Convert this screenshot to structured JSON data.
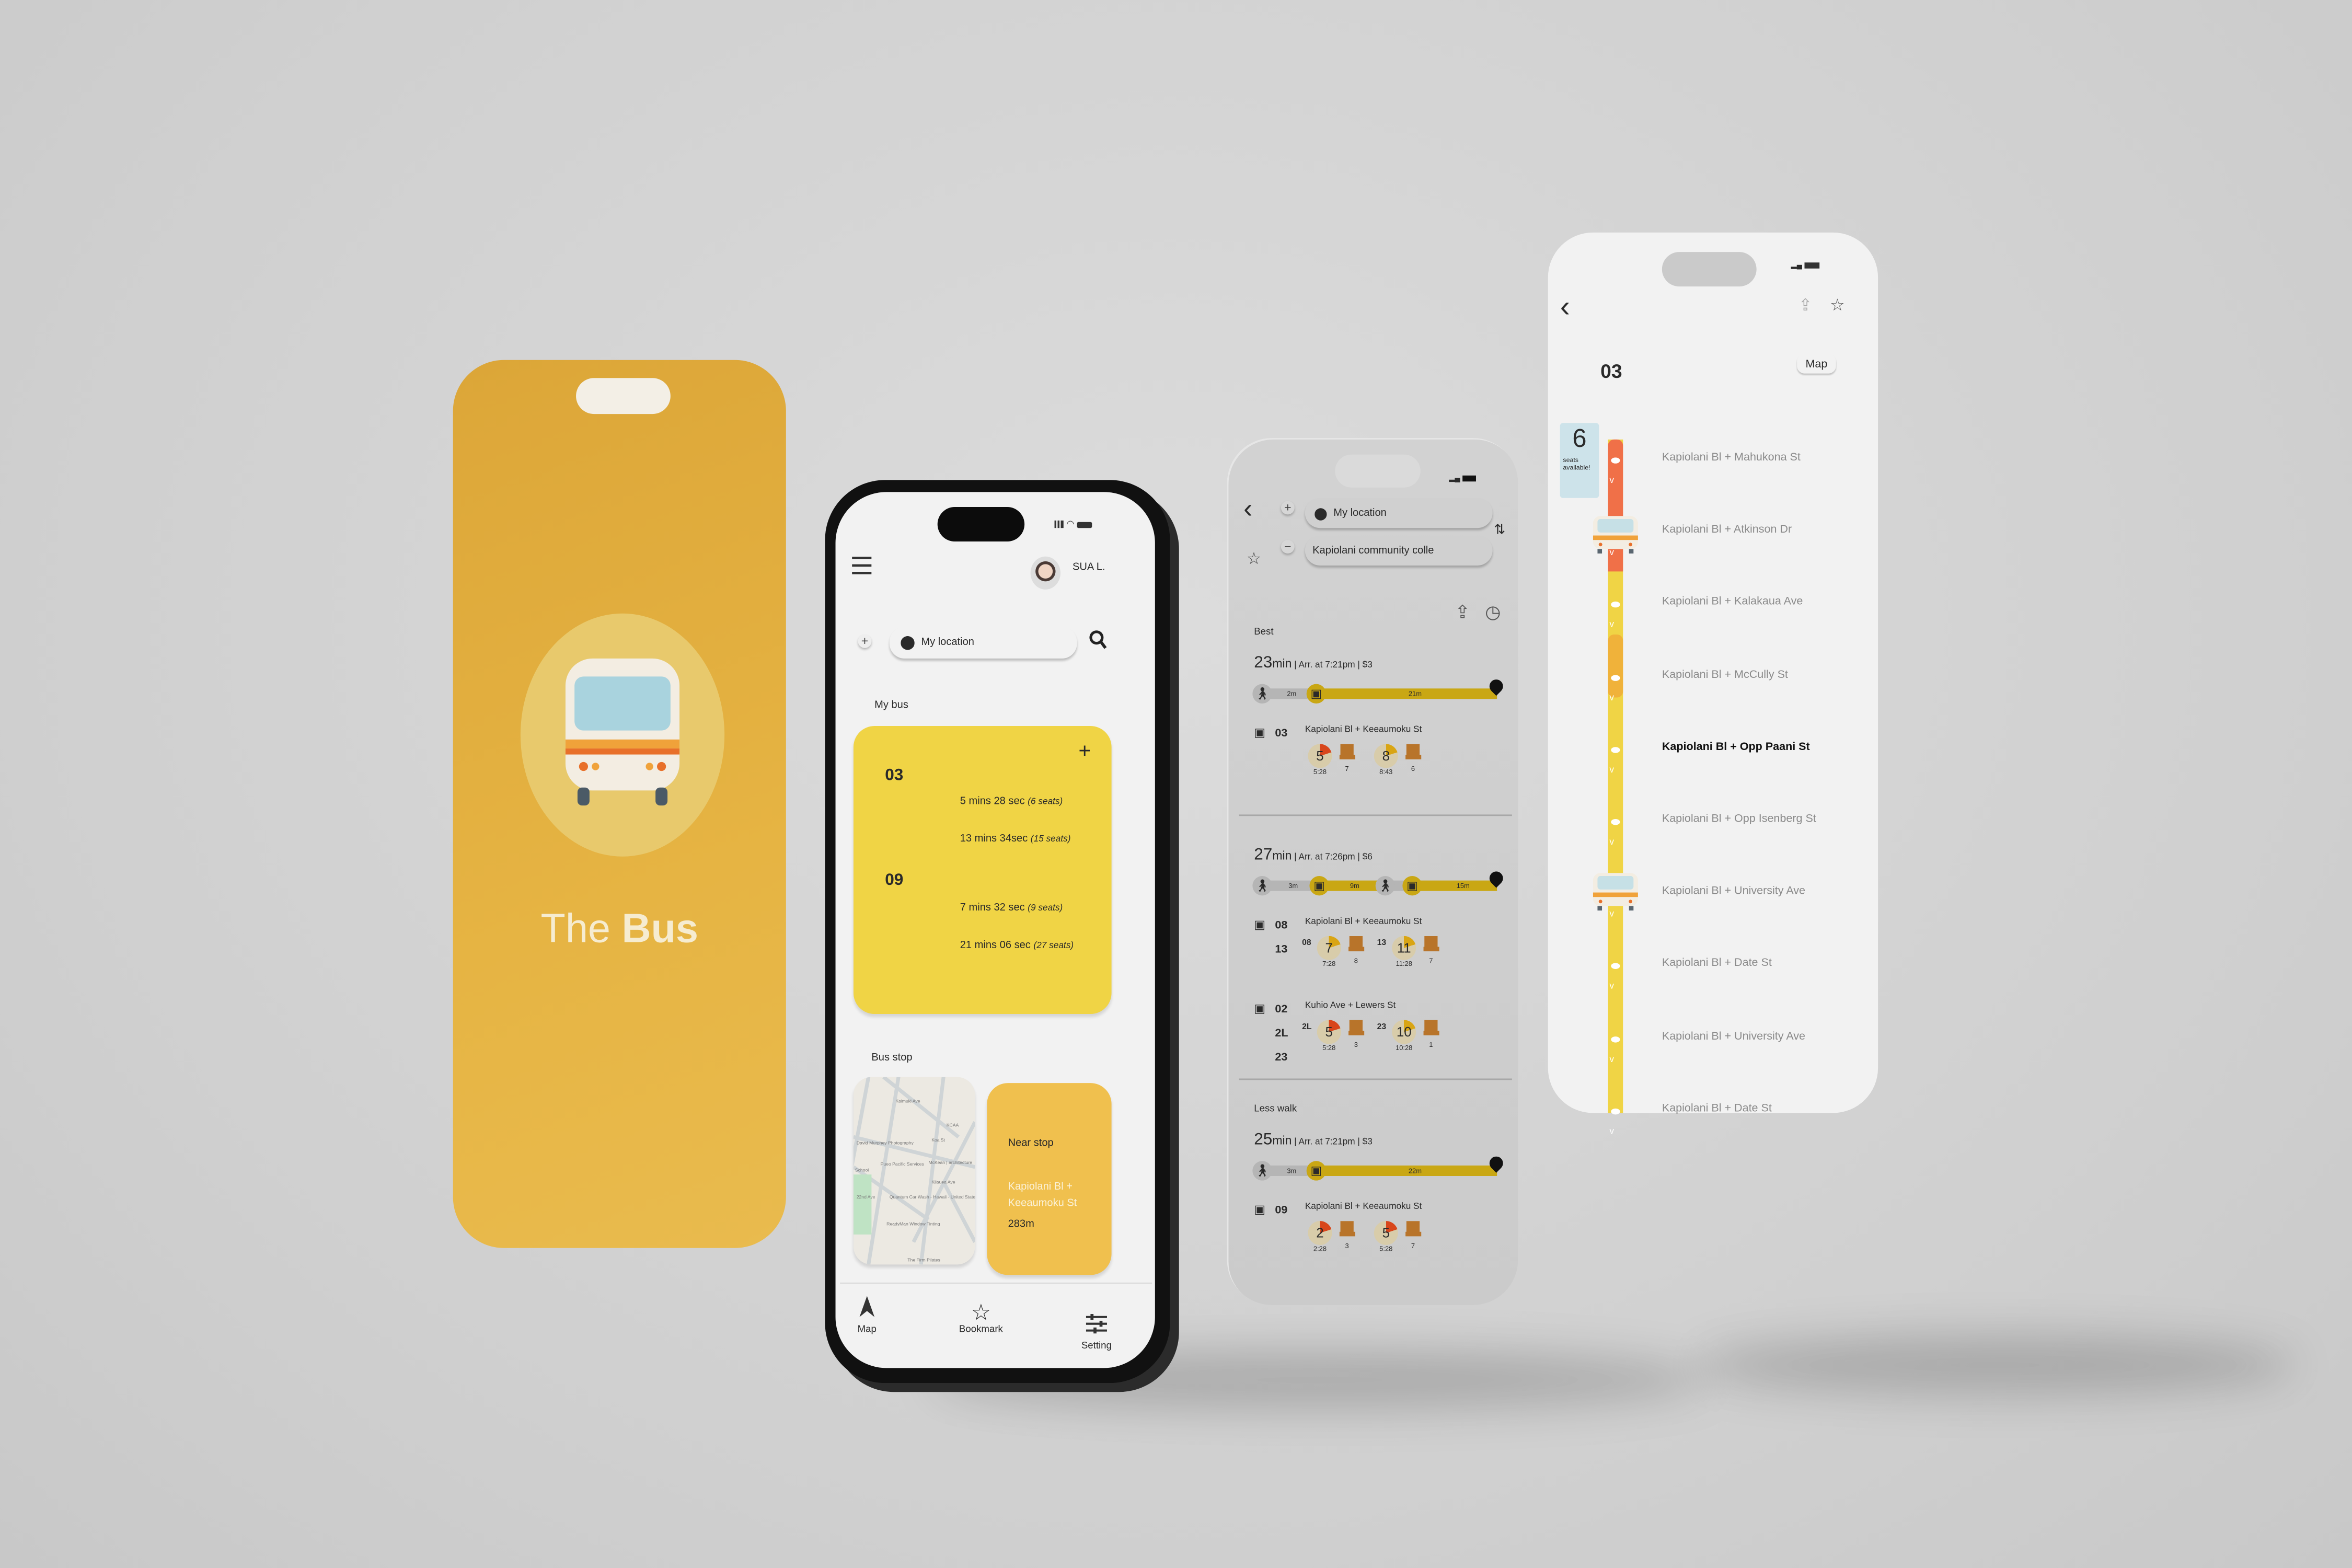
{
  "colors": {
    "splash": "#E3AE3A",
    "card_yellow": "#F0D445",
    "near_stop": "#F0C04E",
    "route_red": "#F07048",
    "route_yellow": "#F0D445",
    "route_orange": "#F0B23A",
    "timeline_bus": "#C9A714",
    "chair": "#B8742A"
  },
  "splash": {
    "title_light": "The",
    "title_bold": "Bus",
    "icon": "bus-front-icon"
  },
  "home": {
    "user_name": "SUA L.",
    "search": {
      "value": "My location"
    },
    "my_bus_label": "My bus",
    "buses": [
      {
        "route": "03",
        "arrivals": [
          {
            "time": "5 mins 28 sec",
            "seats": "(6 seats)"
          },
          {
            "time": "13 mins 34sec",
            "seats": "(15 seats)"
          }
        ]
      },
      {
        "route": "09",
        "arrivals": [
          {
            "time": "7 mins 32 sec",
            "seats": "(9 seats)"
          },
          {
            "time": "21 mins 06 sec",
            "seats": "(27 seats)"
          }
        ]
      }
    ],
    "bus_stop_label": "Bus stop",
    "map_labels": [
      "David Murphey Photography",
      "Pueo Pacific Services",
      "McKean | architecture",
      "Quantum Car Wash - Hawaii - United States",
      "ReadyMan Window Tinting",
      "The Firm Pilates",
      "Kaimuki Ave",
      "Koa St",
      "Kilauea Ave",
      "22nd Ave",
      "School",
      "KCAA"
    ],
    "near_stop": {
      "title": "Near stop",
      "name": "Kapiolani Bl + Keeaumoku St",
      "distance": "283m"
    },
    "nav": [
      {
        "label": "Map",
        "icon": "navigation-arrow-icon"
      },
      {
        "label": "Bookmark",
        "icon": "star-icon"
      },
      {
        "label": "Setting",
        "icon": "sliders-icon"
      }
    ]
  },
  "routes": {
    "from": "My location",
    "to": "Kapiolani community colle",
    "options": [
      {
        "section": "Best",
        "duration": "23",
        "unit": "min",
        "arrival": "Arr. at 7:21pm",
        "price": "$3",
        "timeline": [
          {
            "type": "walk",
            "label": "2m"
          },
          {
            "type": "bus",
            "label": "21m"
          }
        ],
        "rows": [
          {
            "routes": [
              "03"
            ],
            "stop": "Kapiolani Bl + Keeaumoku St",
            "groups": [
              {
                "route": "",
                "legs": [
                  {
                    "min": "5",
                    "time": "5:28",
                    "seats": "7",
                    "level": "red"
                  },
                  {
                    "min": "8",
                    "time": "8:43",
                    "seats": "6",
                    "level": "yellow"
                  }
                ]
              }
            ]
          }
        ]
      },
      {
        "section": "",
        "duration": "27",
        "unit": "min",
        "arrival": "Arr. at 7:26pm",
        "price": "$6",
        "timeline": [
          {
            "type": "walk",
            "label": "3m"
          },
          {
            "type": "bus",
            "label": "9m"
          },
          {
            "type": "walk",
            "label": ""
          },
          {
            "type": "bus",
            "label": "15m"
          }
        ],
        "rows": [
          {
            "routes": [
              "08",
              "13"
            ],
            "stop": "Kapiolani Bl + Keeaumoku St",
            "groups": [
              {
                "route": "08",
                "legs": [
                  {
                    "min": "7",
                    "time": "7:28",
                    "seats": "8",
                    "level": "yellow"
                  }
                ]
              },
              {
                "route": "13",
                "legs": [
                  {
                    "min": "11",
                    "time": "11:28",
                    "seats": "7",
                    "level": "yellow"
                  }
                ]
              }
            ]
          },
          {
            "routes": [
              "02",
              "2L",
              "23"
            ],
            "stop": "Kuhio Ave + Lewers St",
            "groups": [
              {
                "route": "2L",
                "legs": [
                  {
                    "min": "5",
                    "time": "5:28",
                    "seats": "3",
                    "level": "red"
                  }
                ]
              },
              {
                "route": "23",
                "legs": [
                  {
                    "min": "10",
                    "time": "10:28",
                    "seats": "1",
                    "level": "yellow"
                  }
                ]
              }
            ]
          }
        ]
      },
      {
        "section": "Less walk",
        "duration": "25",
        "unit": "min",
        "arrival": "Arr. at 7:21pm",
        "price": "$3",
        "timeline": [
          {
            "type": "walk",
            "label": "3m"
          },
          {
            "type": "bus",
            "label": "22m"
          }
        ],
        "rows": [
          {
            "routes": [
              "09"
            ],
            "stop": "Kapiolani Bl + Keeaumoku St",
            "groups": [
              {
                "route": "",
                "legs": [
                  {
                    "min": "2",
                    "time": "2:28",
                    "seats": "3",
                    "level": "red"
                  },
                  {
                    "min": "5",
                    "time": "5:28",
                    "seats": "7",
                    "level": "red"
                  }
                ]
              }
            ]
          }
        ]
      }
    ]
  },
  "detail": {
    "route": "03",
    "map_button": "Map",
    "seats_badge": {
      "count": "6",
      "line1": "seats",
      "line2": "available!"
    },
    "current_stop_index": 4,
    "stops": [
      "Kapiolani Bl + Mahukona St",
      "Kapiolani Bl + Atkinson Dr",
      "Kapiolani Bl + Kalakaua Ave",
      "Kapiolani Bl + McCully St",
      "Kapiolani Bl + Opp Paani St",
      "Kapiolani Bl + Opp Isenberg St",
      "Kapiolani Bl + University Ave",
      "Kapiolani Bl + Date St",
      "Kapiolani Bl + University Ave",
      "Kapiolani Bl + Date St"
    ]
  }
}
